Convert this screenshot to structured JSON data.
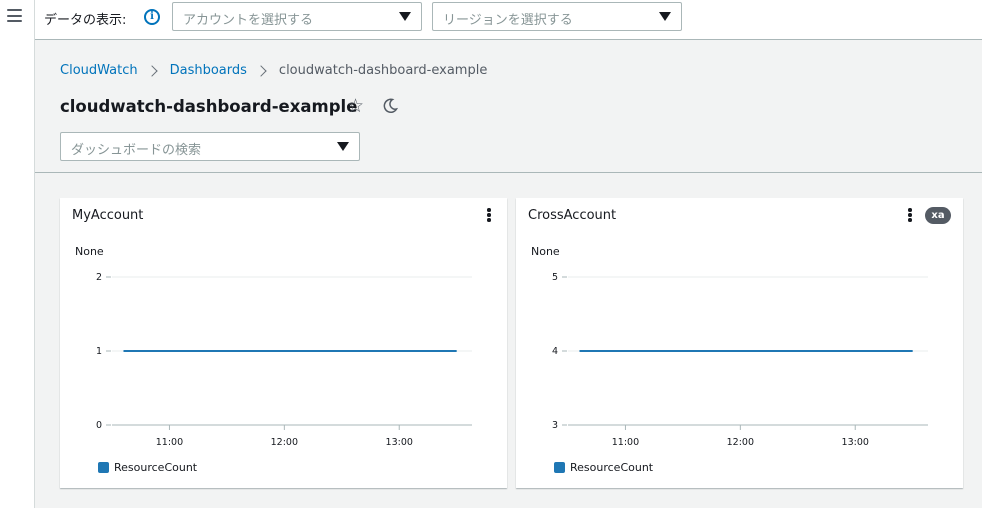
{
  "topbar": {
    "view_label": "データの表示:",
    "info_icon_glyph": "i",
    "account_placeholder": "アカウントを選択する",
    "region_placeholder": "リージョンを選択する"
  },
  "breadcrumb": {
    "items": [
      "CloudWatch",
      "Dashboards"
    ],
    "current": "cloudwatch-dashboard-example"
  },
  "page": {
    "title": "cloudwatch-dashboard-example",
    "dashboard_search_placeholder": "ダッシュボードの検索"
  },
  "widgets": [
    {
      "title": "MyAccount",
      "unit_label": "None",
      "badge": "",
      "legend": "ResourceCount"
    },
    {
      "title": "CrossAccount",
      "unit_label": "None",
      "badge": "xa",
      "legend": "ResourceCount"
    }
  ],
  "colors": {
    "series": "#1f77b4",
    "link": "#0073bb"
  },
  "chart_data": [
    {
      "type": "line",
      "x": [
        "10:36",
        "13:30"
      ],
      "series": [
        {
          "name": "ResourceCount",
          "values": [
            1,
            1
          ]
        }
      ],
      "xticks": [
        "11:00",
        "12:00",
        "13:00"
      ],
      "xrange_minutes": [
        630,
        818
      ],
      "yticks": [
        0,
        1,
        2
      ],
      "ylim": [
        0,
        2
      ],
      "ylabel": "None",
      "grid": true,
      "legend": "bottom-left"
    },
    {
      "type": "line",
      "x": [
        "10:36",
        "13:30"
      ],
      "series": [
        {
          "name": "ResourceCount",
          "values": [
            4,
            4
          ]
        }
      ],
      "xticks": [
        "11:00",
        "12:00",
        "13:00"
      ],
      "xrange_minutes": [
        630,
        818
      ],
      "yticks": [
        3,
        4,
        5
      ],
      "ylim": [
        3,
        5
      ],
      "ylabel": "None",
      "grid": true,
      "legend": "bottom-left"
    }
  ]
}
